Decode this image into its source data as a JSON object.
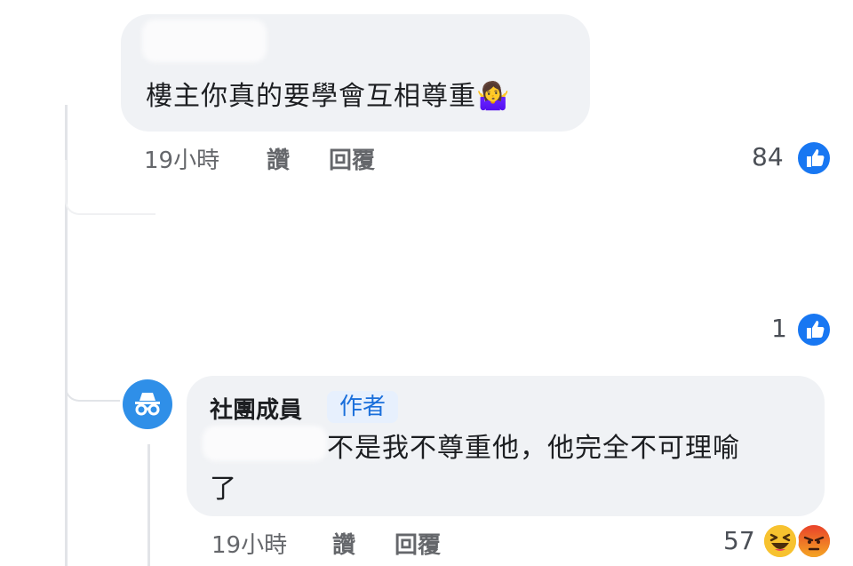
{
  "comment1": {
    "text": "樓主你真的要學會互相尊重🤷‍♀️",
    "time": "19小時",
    "like_label": "讚",
    "reply_label": "回覆",
    "reaction_count": "84"
  },
  "collapsed": {
    "reaction_count": "1"
  },
  "comment2": {
    "author": "社團成員",
    "author_badge": "作者",
    "text_line1": "不是我不尊重他，他完全不可理喻",
    "text_line2": "了",
    "time": "19小時",
    "like_label": "讚",
    "reply_label": "回覆",
    "reaction_count": "57"
  },
  "colors": {
    "like_blue": "#1877f2",
    "bubble_bg": "#f0f2f5",
    "meta_gray": "#65676b",
    "badge_bg": "#e7f0fd",
    "badge_text": "#1a6fdb",
    "avatar_blue": "#2f8fe8"
  },
  "icons": [
    "like-icon",
    "incognito-avatar-icon",
    "haha-reaction-icon",
    "angry-reaction-icon"
  ]
}
